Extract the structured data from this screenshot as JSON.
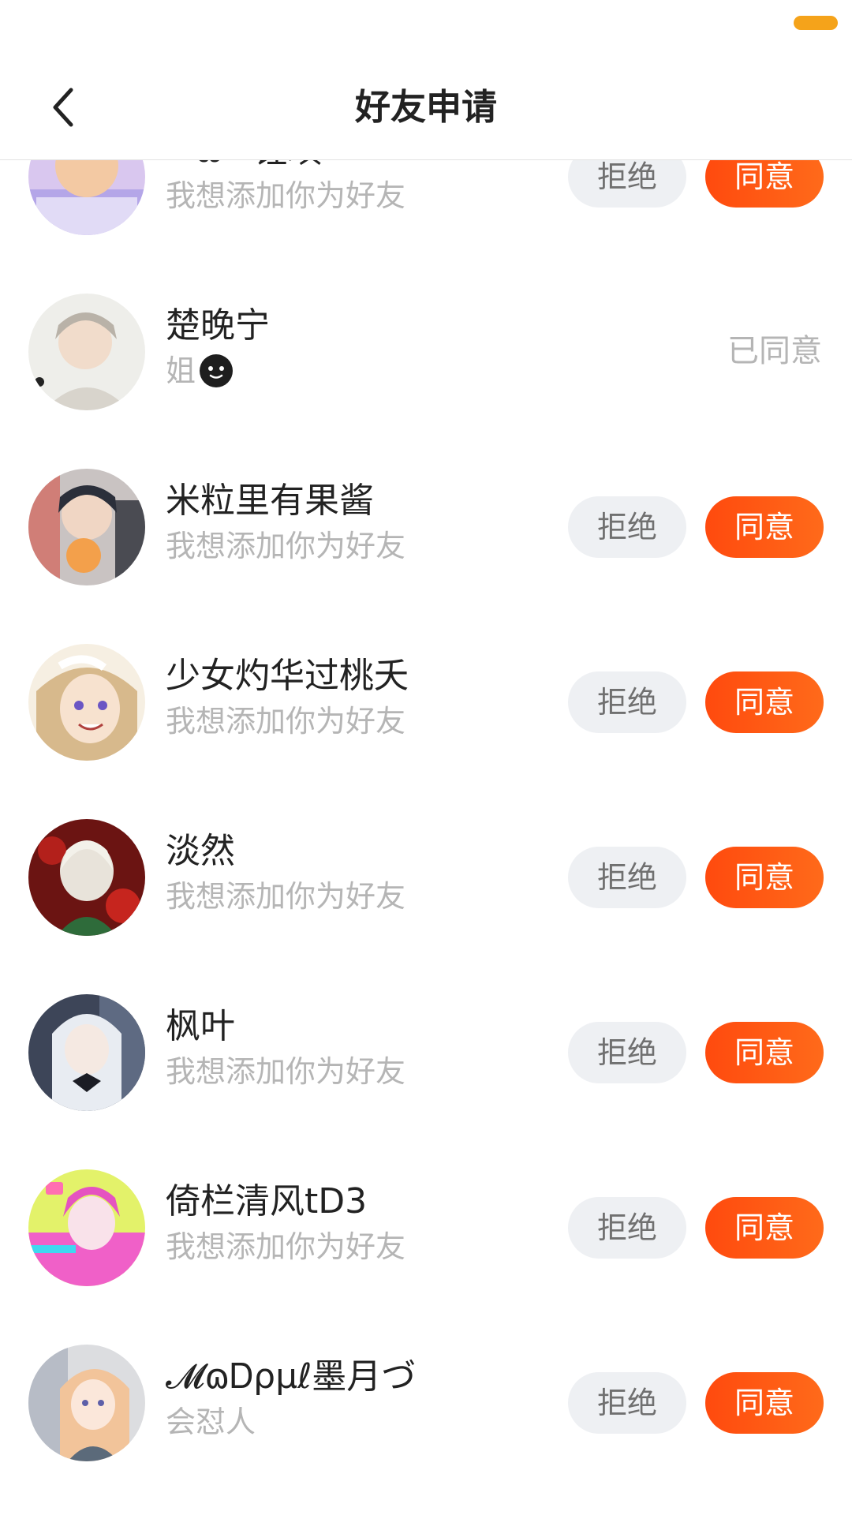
{
  "header": {
    "title": "好友申请"
  },
  "colors": {
    "accent": "#ff5a14",
    "reject_bg": "#eef0f3",
    "battery": "#f5a31a"
  },
  "requests": [
    {
      "name": "^ω^锂瑱",
      "subtitle": "我想添加你为好友",
      "reject_label": "拒绝",
      "accept_label": "同意"
    },
    {
      "name": "楚晚宁",
      "subtitle": "姐",
      "status": "已同意"
    },
    {
      "name": "米粒里有果酱",
      "subtitle": "我想添加你为好友",
      "reject_label": "拒绝",
      "accept_label": "同意"
    },
    {
      "name": "少女灼华过桃夭",
      "subtitle": "我想添加你为好友",
      "reject_label": "拒绝",
      "accept_label": "同意"
    },
    {
      "name": "淡然",
      "subtitle": "我想添加你为好友",
      "reject_label": "拒绝",
      "accept_label": "同意"
    },
    {
      "name": "枫叶",
      "subtitle": "我想添加你为好友",
      "reject_label": "拒绝",
      "accept_label": "同意"
    },
    {
      "name": "倚栏清风tD3",
      "subtitle": "我想添加你为好友",
      "reject_label": "拒绝",
      "accept_label": "同意"
    },
    {
      "name": "𝓜ɷᎠρμℓ墨月づ",
      "subtitle": "会怼人",
      "reject_label": "拒绝",
      "accept_label": "同意"
    }
  ]
}
